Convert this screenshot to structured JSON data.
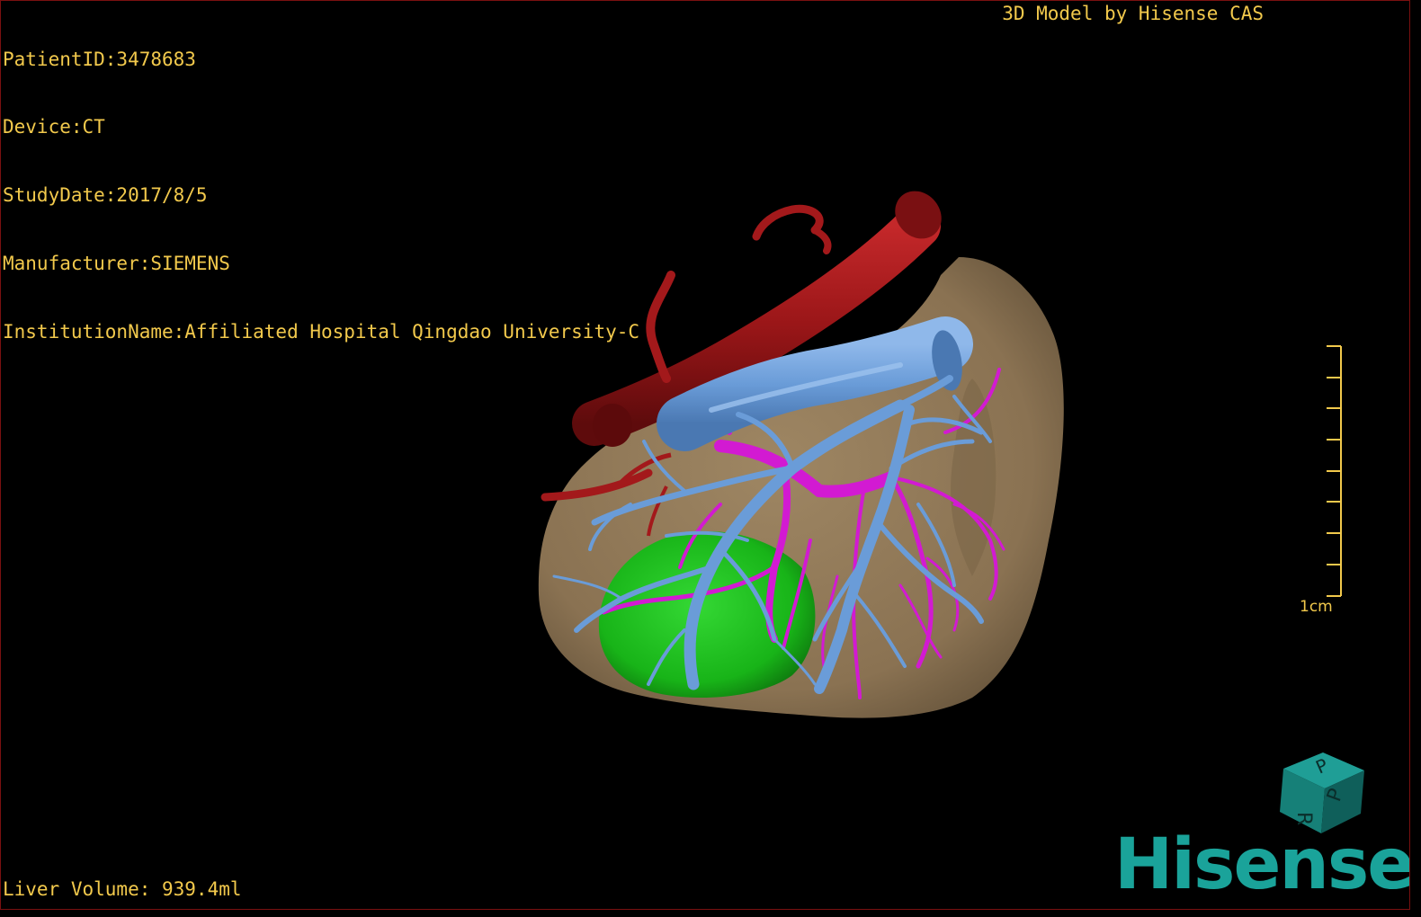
{
  "overlay": {
    "patient_id": "PatientID:3478683",
    "device": "Device:CT",
    "study_date": "StudyDate:2017/8/5",
    "manufacturer": "Manufacturer:SIEMENS",
    "institution": "InstitutionName:Affiliated Hospital Qingdao University-C",
    "model_title": "3D Model by Hisense CAS",
    "liver_volume": "Liver Volume: 939.4ml",
    "scale_label": "1cm"
  },
  "branding": {
    "logo": "Hisense",
    "cube_letters": [
      "P",
      "R",
      "P"
    ]
  },
  "colors": {
    "background": "#000000",
    "overlay_text": "#f2c94c",
    "liver": "#8c7556",
    "artery": "#a3191b",
    "portal_vein": "#6699d6",
    "hepatic_vein": "#d21ad2",
    "tumor": "#1fbf1f",
    "brand": "#1aa39a"
  },
  "structures": [
    "liver-surface",
    "aorta",
    "portal-vein",
    "hepatic-veins",
    "tumor"
  ],
  "icons": [
    "orientation-cube-icon",
    "scale-bar-icon",
    "hisense-logo"
  ]
}
